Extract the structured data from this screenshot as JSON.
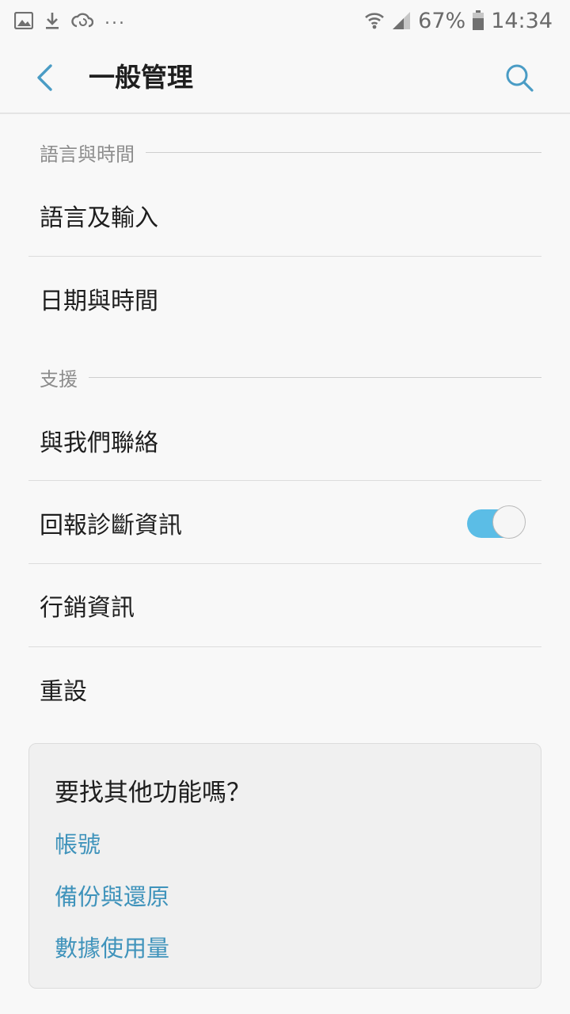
{
  "status_bar": {
    "more": "...",
    "battery": "67%",
    "time": "14:34"
  },
  "app_bar": {
    "title": "一般管理"
  },
  "sections": {
    "language_time": {
      "header": "語言與時間",
      "items": [
        "語言及輸入",
        "日期與時間"
      ]
    },
    "support": {
      "header": "支援",
      "items": [
        "與我們聯絡",
        "回報診斷資訊",
        "行銷資訊",
        "重設"
      ]
    }
  },
  "report_toggle": {
    "on": true
  },
  "suggestions": {
    "title": "要找其他功能嗎？",
    "links": [
      "帳號",
      "備份與還原",
      "數據使用量"
    ]
  },
  "colors": {
    "accent": "#5bbde6",
    "link": "#3f93bb",
    "icon_blue": "#4a9cc5"
  }
}
